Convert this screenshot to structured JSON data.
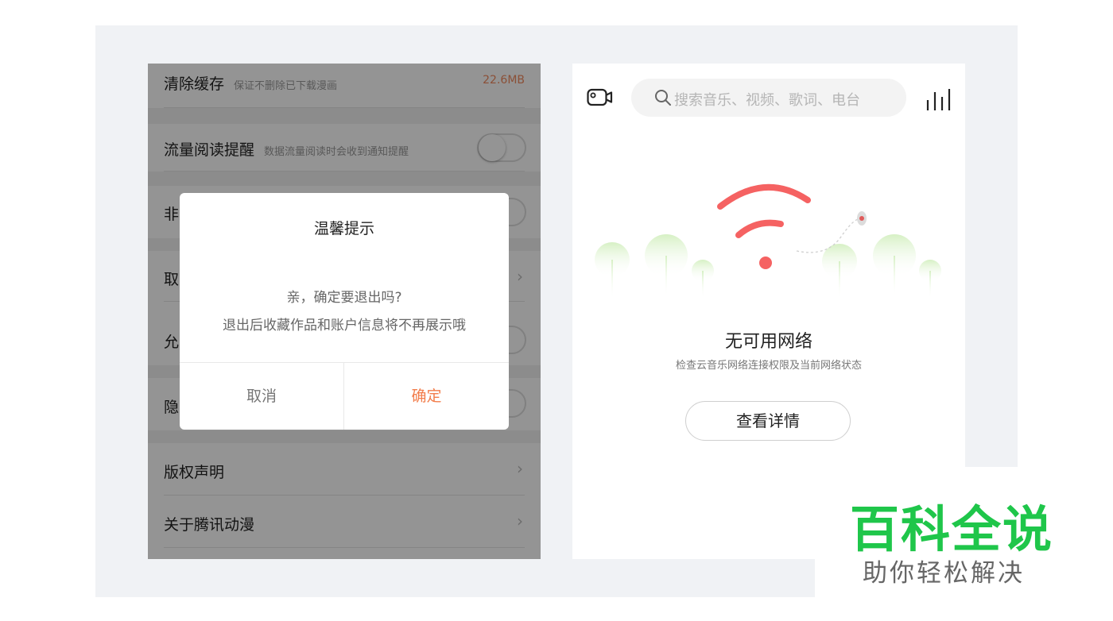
{
  "settings_screen": {
    "rows": [
      {
        "title": "清除缓存",
        "subtitle": "保证不删除已下载漫画",
        "value": "22.6MB"
      },
      {
        "title": "流量阅读提醒",
        "subtitle": "数据流量阅读时会收到通知提醒"
      },
      {
        "title": "非"
      },
      {
        "title": "取"
      },
      {
        "title": "允"
      },
      {
        "title": "隐"
      },
      {
        "title": "版权声明"
      },
      {
        "title": "关于腾讯动漫"
      }
    ],
    "dialog": {
      "title": "温馨提示",
      "message_line1": "亲，确定要退出吗?",
      "message_line2": "退出后收藏作品和账户信息将不再展示哦",
      "cancel_label": "取消",
      "confirm_label": "确定"
    }
  },
  "music_screen": {
    "search_placeholder": "搜索音乐、视频、歌词、电台",
    "icons": [
      "video-camera-icon",
      "search-icon",
      "equalizer-icon"
    ],
    "empty_state": {
      "title": "无可用网络",
      "subtitle": "检查云音乐网络连接权限及当前网络状态",
      "button_label": "查看详情"
    }
  },
  "watermark": {
    "brand": "百科全说",
    "slogan": "助你轻松解决"
  },
  "colors": {
    "accent_orange": "#f27d4b",
    "wifi_red": "#f56262",
    "tree_green": "#d6f0c4",
    "brand_green": "#1fc64a"
  }
}
